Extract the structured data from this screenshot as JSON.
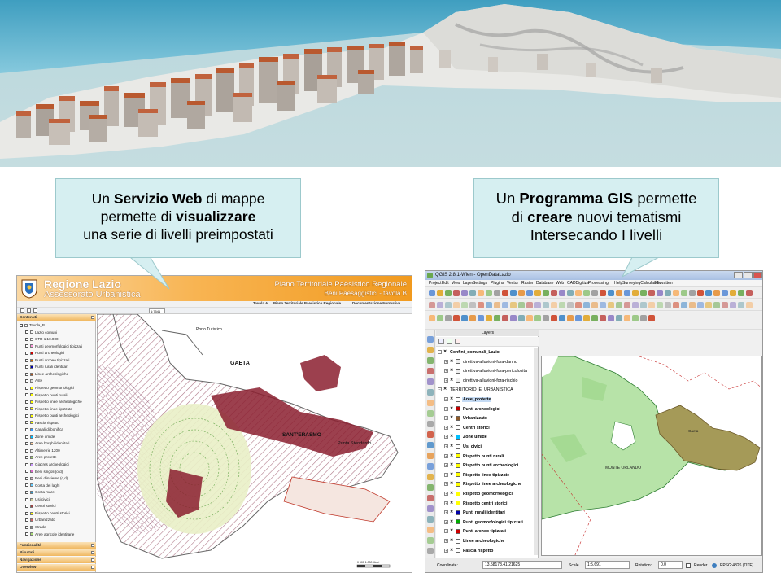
{
  "banner": {
    "description_icon": "3d-city-model"
  },
  "callout_left": {
    "line1_pre": "Un ",
    "line1_bold": "Servizio Web",
    "line1_post": " di mappe",
    "line2_pre": "permette di ",
    "line2_bold": "visualizzare",
    "line3": "una serie di livelli preimpostati"
  },
  "callout_right": {
    "line1_pre": "Un ",
    "line1_bold": "Programma GIS",
    "line1_post": " permette",
    "line2_pre": "di ",
    "line2_bold": "creare",
    "line2_post": " nuovi tematismi",
    "line3": "Intersecando I livelli"
  },
  "web_viewer": {
    "org": "Regione Lazio",
    "dept": "Assessorato Urbanistica",
    "title1": "Piano Territoriale Paesistico Regionale",
    "title2": "Beni Paesaggistici - tavola B",
    "nav": [
      "Tavola A",
      "Piano Territoriale Paesistico Regionale",
      "Documentazione Normativa"
    ],
    "scale": "1:7541",
    "panel_header": "Contenuti",
    "panel_footer": [
      "Funzionalità",
      "Risultati",
      "Navigazione",
      "Overview"
    ],
    "layers": [
      "Tavola_B",
      "Lazio comuni",
      "CTR 1:10.000",
      "Punti geomorfologici tipizzati",
      "Punti archeologici",
      "Punti archeo tipizzati",
      "Punti rurali identitari",
      "Linee archeologiche",
      "Aste",
      "Rispetto geomorfologici",
      "Rispetto punti rurali",
      "Rispetto linee archeologiche",
      "Rispetto linee tipizzate",
      "Rispetto punti archeologici",
      "Fascia rispetto",
      "Canali di bonifica",
      "Zone umide",
      "Aree borghi identitari",
      "Altimetrie 1200",
      "Aree protette",
      "Giacres archeologici",
      "Beni singoli (o,d)",
      "Beni d'insieme (c,d)",
      "Costa dei laghi",
      "Costa mare",
      "Usi civici",
      "Centri storici",
      "Rispetto centri storici",
      "Urbanizzato",
      "Strade",
      "Aree agricole identitarie"
    ],
    "map_labels": [
      "GAETA",
      "SANT'ERASMO",
      "Punta Stendardo",
      "Porto Turistico"
    ],
    "scalebar": "0   500  1.000   Metri"
  },
  "qgis": {
    "title": "QGIS 2.8.1-Wien - OpenDataLazio",
    "menu": [
      "Project",
      "Edit",
      "View",
      "Layer",
      "Settings",
      "Plugins",
      "Vector",
      "Raster",
      "Database",
      "Web",
      "CADDigitize",
      "Processing",
      "Help",
      "SurveyingCalculation",
      "Midvatten"
    ],
    "layers_panel_title": "Layers",
    "layers": [
      {
        "name": "Confini_comunali_Lazio",
        "bold": true,
        "swatch": ""
      },
      {
        "name": "direttiva-alluvioni-fora-danno",
        "bold": false,
        "swatch": "#eeeeee"
      },
      {
        "name": "direttiva-alluvioni-fora-pericolosita",
        "bold": false,
        "swatch": "#eeeeee"
      },
      {
        "name": "direttiva-alluvioni-fora-rischio",
        "bold": false,
        "swatch": "#eeeeee"
      },
      {
        "name": "TERRITORIO_E_URBANISTICA",
        "bold": false,
        "swatch": ""
      },
      {
        "name": "Aree_protette",
        "bold": true,
        "swatch": "#ffffff"
      },
      {
        "name": "Punti archeologici",
        "bold": true,
        "swatch": "#c00000"
      },
      {
        "name": "Urbanizzato",
        "bold": true,
        "swatch": "#8b5a2b"
      },
      {
        "name": "Centri storici",
        "bold": true,
        "swatch": "#ffffff"
      },
      {
        "name": "Zone umide",
        "bold": true,
        "swatch": "#00bfff"
      },
      {
        "name": "Usi civici",
        "bold": true,
        "swatch": "#ffffff"
      },
      {
        "name": "Rispetto punti rurali",
        "bold": true,
        "swatch": "#ffff00"
      },
      {
        "name": "Rispetto punti archeologici",
        "bold": true,
        "swatch": "#ffff00"
      },
      {
        "name": "Rispetto linee tipizzate",
        "bold": true,
        "swatch": "#ffff00"
      },
      {
        "name": "Rispetto linee archeologiche",
        "bold": true,
        "swatch": "#ffff00"
      },
      {
        "name": "Rispetto geomorfologici",
        "bold": true,
        "swatch": "#ffff00"
      },
      {
        "name": "Rispetto centri storici",
        "bold": true,
        "swatch": "#ffff00"
      },
      {
        "name": "Punti rurali identitari",
        "bold": true,
        "swatch": "#0000aa"
      },
      {
        "name": "Punti geomorfologici tipizzati",
        "bold": true,
        "swatch": "#00aa00"
      },
      {
        "name": "Punti archeo tipizzati",
        "bold": true,
        "swatch": "#cc0000"
      },
      {
        "name": "Linee archeologiche",
        "bold": true,
        "swatch": "#ffffff"
      },
      {
        "name": "Fascia rispetto",
        "bold": true,
        "swatch": "#ffffff"
      }
    ],
    "map_labels": [
      "MONTE ORLANDO",
      "Gaeta"
    ],
    "status": {
      "coordinate_label": "Coordinate:",
      "coordinate": "13.58173,41.21625",
      "scale_label": "Scale",
      "scale": "1:5,691",
      "rotation_label": "Rotation:",
      "rotation": "0.0",
      "render": "Render",
      "crs": "EPSG:4326 (OTF)"
    }
  },
  "colors": {
    "callout_bg": "#d6eff1",
    "viewer_header": "#f19a1e",
    "qgis_green": "#b7e3a8",
    "qgis_brown": "#a59a58"
  }
}
